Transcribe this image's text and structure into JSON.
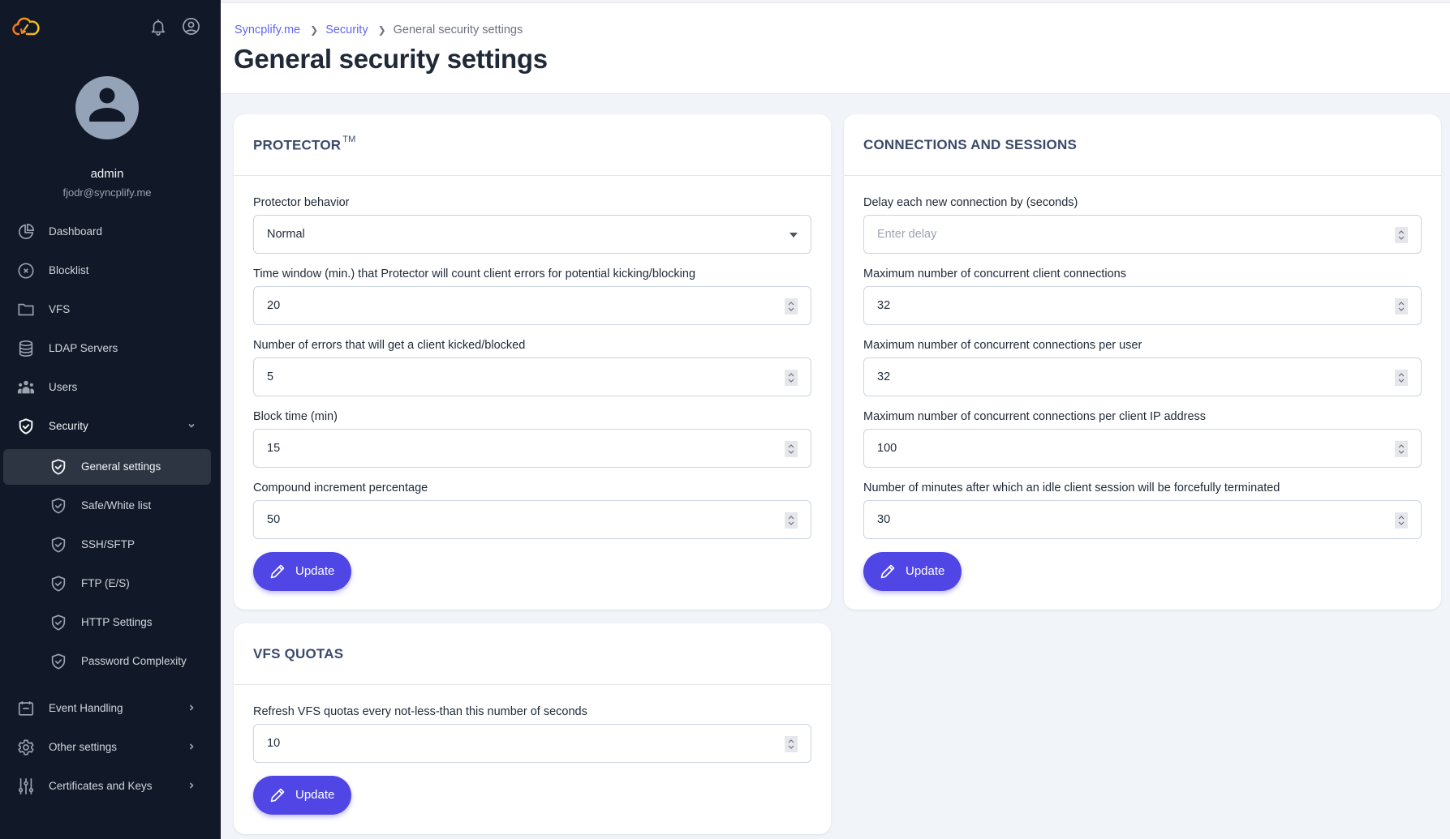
{
  "app": {
    "logo_icon": "syncplify-cloud-logo",
    "notifications_icon": "bell-icon",
    "account_icon": "user-circle-icon"
  },
  "profile": {
    "name": "admin",
    "email": "fjodr@syncplify.me"
  },
  "sidebar": {
    "items": [
      {
        "label": "Dashboard",
        "icon": "pie-chart-icon"
      },
      {
        "label": "Blocklist",
        "icon": "x-circle-icon"
      },
      {
        "label": "VFS",
        "icon": "folder-icon"
      },
      {
        "label": "LDAP Servers",
        "icon": "database-icon"
      },
      {
        "label": "Users",
        "icon": "users-icon"
      },
      {
        "label": "Security",
        "icon": "shield-check-icon",
        "expanded": true
      },
      {
        "label": "Event Handling",
        "icon": "calendar-icon"
      },
      {
        "label": "Other settings",
        "icon": "gear-icon"
      },
      {
        "label": "Certificates and Keys",
        "icon": "sliders-icon"
      }
    ],
    "security_sub": [
      {
        "label": "General settings",
        "active": true
      },
      {
        "label": "Safe/White list"
      },
      {
        "label": "SSH/SFTP"
      },
      {
        "label": "FTP (E/S)"
      },
      {
        "label": "HTTP Settings"
      },
      {
        "label": "Password Complexity"
      }
    ]
  },
  "header": {
    "breadcrumb": [
      "Syncplify.me",
      "Security",
      "General security settings"
    ],
    "title": "General security settings"
  },
  "protector": {
    "title": "PROTECTOR",
    "trademark": "TM",
    "behavior_label": "Protector behavior",
    "behavior_value": "Normal",
    "fields": [
      {
        "label": "Time window (min.) that Protector will count client errors for potential kicking/blocking",
        "value": "20"
      },
      {
        "label": "Number of errors that will get a client kicked/blocked",
        "value": "5"
      },
      {
        "label": "Block time (min)",
        "value": "15"
      },
      {
        "label": "Compound increment percentage",
        "value": "50"
      }
    ],
    "button": "Update"
  },
  "connections": {
    "title": "CONNECTIONS AND SESSIONS",
    "fields": [
      {
        "label": "Delay each new connection by (seconds)",
        "value": "",
        "placeholder": "Enter delay"
      },
      {
        "label": "Maximum number of concurrent client connections",
        "value": "32",
        "placeholder": ""
      },
      {
        "label": "Maximum number of concurrent connections per user",
        "value": "32",
        "placeholder": ""
      },
      {
        "label": "Maximum number of concurrent connections per client IP address",
        "value": "100",
        "placeholder": ""
      },
      {
        "label": "Number of minutes after which an idle client session will be forcefully terminated",
        "value": "30",
        "placeholder": ""
      }
    ],
    "button": "Update"
  },
  "vfs_quotas": {
    "title": "VFS QUOTAS",
    "field": {
      "label": "Refresh VFS quotas every not-less-than this number of seconds",
      "value": "10"
    },
    "button": "Update"
  },
  "colors": {
    "sidebar_bg": "#111827",
    "accent": "#4f46e5",
    "breadcrumb_link": "#6366f1",
    "card_title": "#3b4a6b",
    "page_bg": "#f1f4f9"
  }
}
